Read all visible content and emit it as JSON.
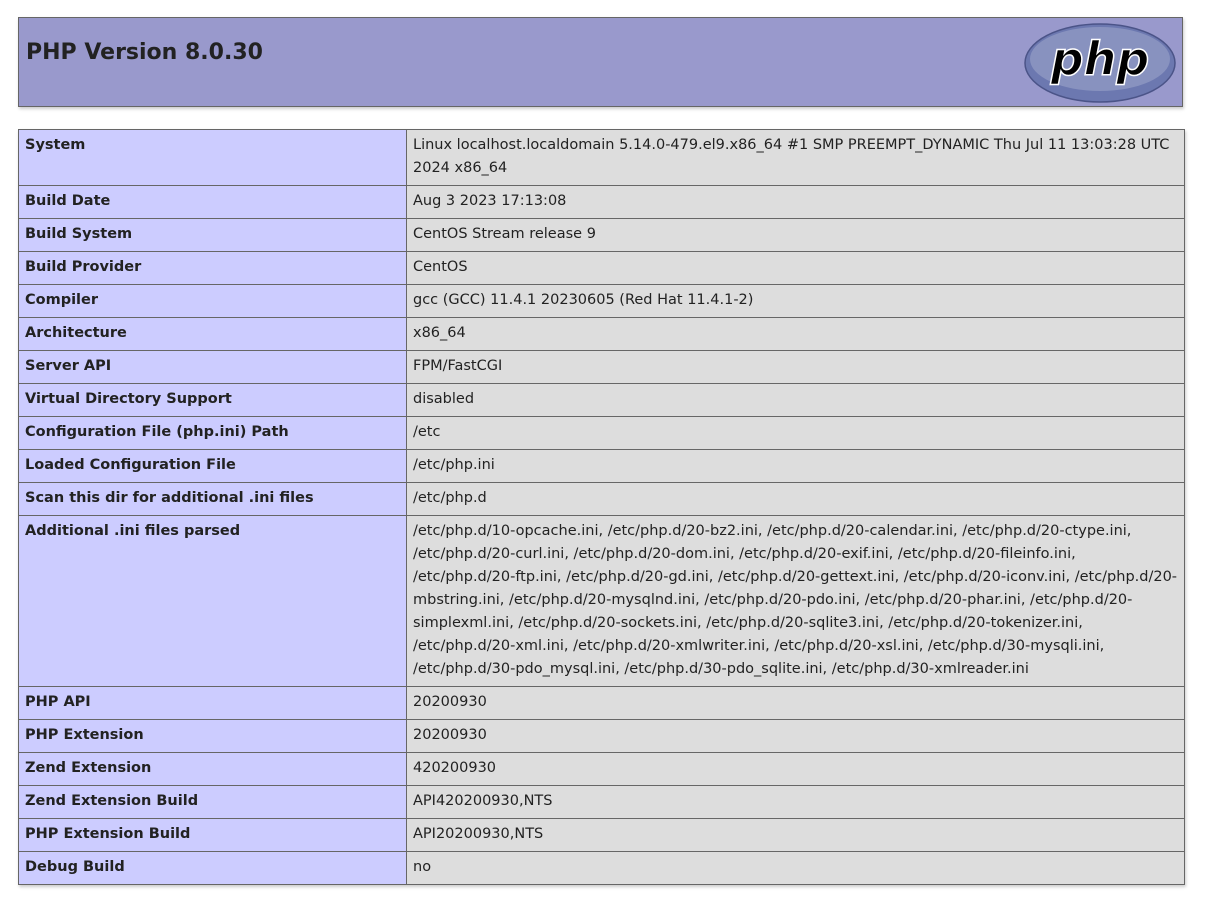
{
  "header": {
    "title": "PHP Version 8.0.30",
    "logo_text": "php"
  },
  "rows": [
    {
      "key": "System",
      "value": "Linux localhost.localdomain 5.14.0-479.el9.x86_64 #1 SMP PREEMPT_DYNAMIC Thu Jul 11 13:03:28 UTC 2024 x86_64"
    },
    {
      "key": "Build Date",
      "value": "Aug 3 2023 17:13:08"
    },
    {
      "key": "Build System",
      "value": "CentOS Stream release 9"
    },
    {
      "key": "Build Provider",
      "value": "CentOS"
    },
    {
      "key": "Compiler",
      "value": "gcc (GCC) 11.4.1 20230605 (Red Hat 11.4.1-2)"
    },
    {
      "key": "Architecture",
      "value": "x86_64"
    },
    {
      "key": "Server API",
      "value": "FPM/FastCGI"
    },
    {
      "key": "Virtual Directory Support",
      "value": "disabled"
    },
    {
      "key": "Configuration File (php.ini) Path",
      "value": "/etc"
    },
    {
      "key": "Loaded Configuration File",
      "value": "/etc/php.ini"
    },
    {
      "key": "Scan this dir for additional .ini files",
      "value": "/etc/php.d"
    },
    {
      "key": "Additional .ini files parsed",
      "value": "/etc/php.d/10-opcache.ini, /etc/php.d/20-bz2.ini, /etc/php.d/20-calendar.ini, /etc/php.d/20-ctype.ini, /etc/php.d/20-curl.ini, /etc/php.d/20-dom.ini, /etc/php.d/20-exif.ini, /etc/php.d/20-fileinfo.ini, /etc/php.d/20-ftp.ini, /etc/php.d/20-gd.ini, /etc/php.d/20-gettext.ini, /etc/php.d/20-iconv.ini, /etc/php.d/20-mbstring.ini, /etc/php.d/20-mysqlnd.ini, /etc/php.d/20-pdo.ini, /etc/php.d/20-phar.ini, /etc/php.d/20-simplexml.ini, /etc/php.d/20-sockets.ini, /etc/php.d/20-sqlite3.ini, /etc/php.d/20-tokenizer.ini, /etc/php.d/20-xml.ini, /etc/php.d/20-xmlwriter.ini, /etc/php.d/20-xsl.ini, /etc/php.d/30-mysqli.ini, /etc/php.d/30-pdo_mysql.ini, /etc/php.d/30-pdo_sqlite.ini, /etc/php.d/30-xmlreader.ini"
    },
    {
      "key": "PHP API",
      "value": "20200930"
    },
    {
      "key": "PHP Extension",
      "value": "20200930"
    },
    {
      "key": "Zend Extension",
      "value": "420200930"
    },
    {
      "key": "Zend Extension Build",
      "value": "API420200930,NTS"
    },
    {
      "key": "PHP Extension Build",
      "value": "API20200930,NTS"
    },
    {
      "key": "Debug Build",
      "value": "no"
    }
  ]
}
